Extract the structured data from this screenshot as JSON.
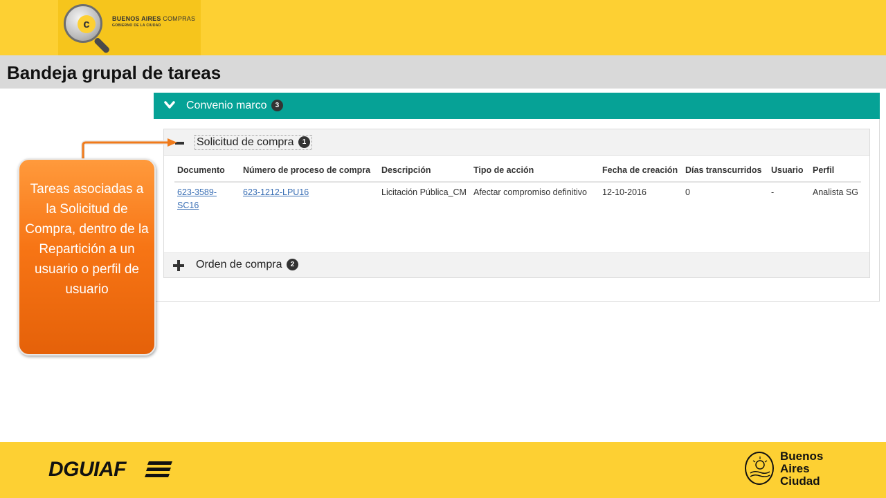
{
  "header": {
    "logo_title_bold": "BUENOS AIRES",
    "logo_title_light": "COMPRAS",
    "logo_subtitle": "GOBIERNO DE LA CIUDAD",
    "logo_letter": "c"
  },
  "page_title": "Bandeja grupal de tareas",
  "convenio": {
    "title": "Convenio marco",
    "count": "3"
  },
  "solicitud": {
    "title": "Solicitud de compra",
    "count": "1"
  },
  "table": {
    "headers": [
      "Documento",
      "Número de proceso de compra",
      "Descripción",
      "Tipo de acción",
      "Fecha de creación",
      "Días transcurridos",
      "Usuario",
      "Perfil"
    ],
    "rows": [
      {
        "documento": "623-3589-SC16",
        "numero_proceso": "623-1212-LPU16",
        "descripcion": "Licitación Pública_CM",
        "tipo_accion": "Afectar compromiso definitivo",
        "fecha_creacion": "12-10-2016",
        "dias": "0",
        "usuario": "-",
        "perfil": "Analista SG"
      }
    ]
  },
  "orden": {
    "title": "Orden de compra",
    "count": "2"
  },
  "callout": {
    "text": "Tareas asociadas a la Solicitud de Compra, dentro de la Repartición a un usuario o perfil de usuario"
  },
  "footer": {
    "left_logo": "DGUIAF",
    "right_logo_line1": "Buenos",
    "right_logo_line2": "Aires",
    "right_logo_line3": "Ciudad"
  },
  "colors": {
    "band_yellow": "#fdd033",
    "teal_header": "#06a296",
    "callout_orange": "#f77515",
    "link_blue": "#3a6fb5"
  }
}
